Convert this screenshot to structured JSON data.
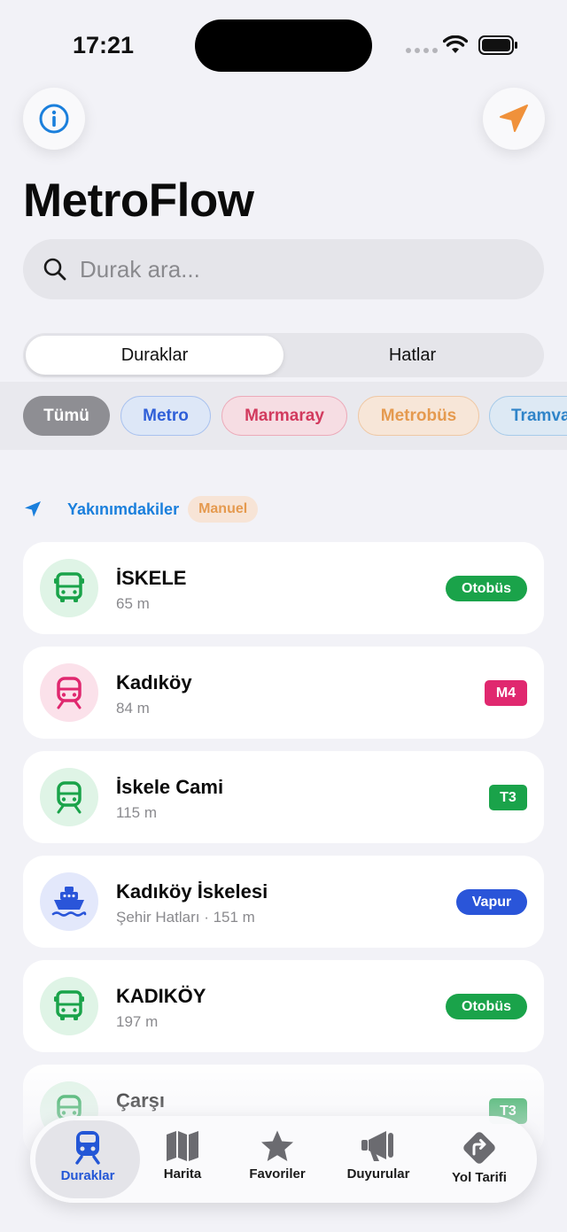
{
  "status_bar": {
    "time": "17:21"
  },
  "app": {
    "title": "MetroFlow"
  },
  "search": {
    "placeholder": "Durak ara..."
  },
  "segments": [
    {
      "label": "Duraklar",
      "active": true
    },
    {
      "label": "Hatlar",
      "active": false
    }
  ],
  "filters": [
    {
      "label": "Tümü"
    },
    {
      "label": "Metro"
    },
    {
      "label": "Marmaray"
    },
    {
      "label": "Metrobüs"
    },
    {
      "label": "Tramvay"
    }
  ],
  "nearby": {
    "label": "Yakınımdakiler",
    "mode_badge": "Manuel"
  },
  "stops": [
    {
      "name": "İSKELE",
      "distance": "65 m",
      "badge": "Otobüs",
      "icon": "bus-icon",
      "badge_color": "#1aa34a",
      "circle_color": "#dff4e6",
      "icon_color": "#1aa34a"
    },
    {
      "name": "Kadıköy",
      "distance": "84 m",
      "badge": "M4",
      "icon": "train-icon",
      "badge_color": "#e0286f",
      "circle_color": "#fbe1ea",
      "icon_color": "#e0286f"
    },
    {
      "name": "İskele Cami",
      "distance": "115 m",
      "badge": "T3",
      "icon": "tram-icon",
      "badge_color": "#1aa34a",
      "circle_color": "#dff4e6",
      "icon_color": "#1aa34a"
    },
    {
      "name": "Kadıköy İskelesi",
      "distance": "Şehir Hatları · 151 m",
      "badge": "Vapur",
      "icon": "ferry-icon",
      "badge_color": "#2a55d9",
      "circle_color": "#e3e8fb",
      "icon_color": "#2a55d9"
    },
    {
      "name": "KADIKÖY",
      "distance": "197 m",
      "badge": "Otobüs",
      "icon": "bus-icon",
      "badge_color": "#1aa34a",
      "circle_color": "#dff4e6",
      "icon_color": "#1aa34a"
    },
    {
      "name": "Çarşı",
      "distance": "",
      "badge": "T3",
      "icon": "tram-icon",
      "badge_color": "#1aa34a",
      "circle_color": "#dff4e6",
      "icon_color": "#1aa34a"
    }
  ],
  "tabs": [
    {
      "label": "Duraklar",
      "icon": "train-icon",
      "active": true
    },
    {
      "label": "Harita",
      "icon": "map-icon",
      "active": false
    },
    {
      "label": "Favoriler",
      "icon": "star-icon",
      "active": false
    },
    {
      "label": "Duyurular",
      "icon": "megaphone-icon",
      "active": false
    },
    {
      "label": "Yol Tarifi",
      "icon": "directions-icon",
      "active": false
    }
  ],
  "colors": {
    "accent": "#2356d6",
    "link": "#1a7fdc",
    "location": "#f0913a"
  }
}
